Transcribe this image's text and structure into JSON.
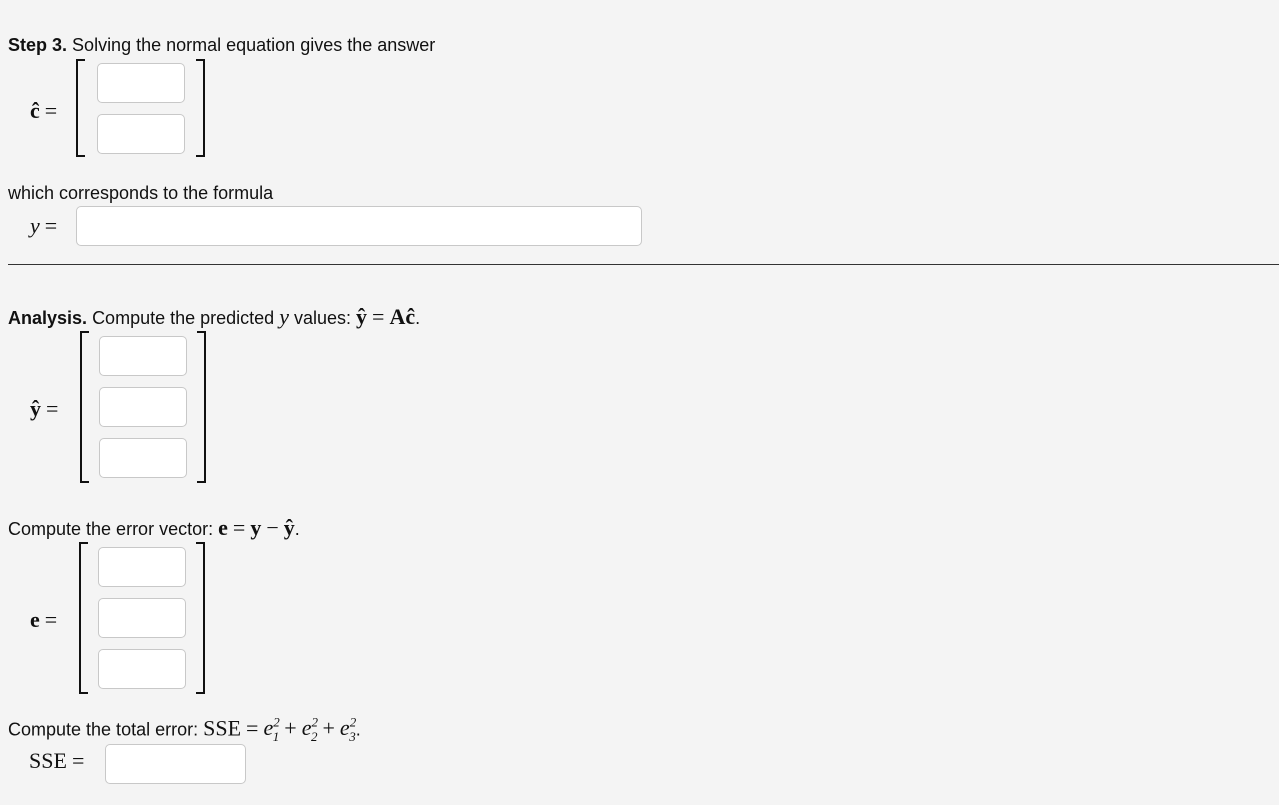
{
  "step3": {
    "heading": "Step 3.",
    "text": "Solving the normal equation gives the answer",
    "c_hat_label": "ĉ",
    "equals": "=",
    "formula_text": "which corresponds to the formula",
    "y_label": "y"
  },
  "analysis": {
    "heading": "Analysis.",
    "text_before": "Compute the predicted",
    "y_var": "y",
    "text_mid": "values:",
    "y_hat": "ŷ",
    "eq": "=",
    "A": "A",
    "c_hat": "ĉ",
    "period": ".",
    "y_hat_label": "ŷ",
    "equals": "="
  },
  "error": {
    "text": "Compute the error vector:",
    "e": "e",
    "eq": "=",
    "y": "y",
    "minus": "−",
    "y_hat": "ŷ",
    "period": ".",
    "e_label": "e",
    "equals": "="
  },
  "sse": {
    "text": "Compute the total error:",
    "SSE": "SSE",
    "eq": "=",
    "e": "e",
    "plus": "+",
    "sup": "2",
    "sub1": "1",
    "sub2": "2",
    "sub3": "3",
    "period": ".",
    "label": "SSE",
    "equals": "="
  }
}
